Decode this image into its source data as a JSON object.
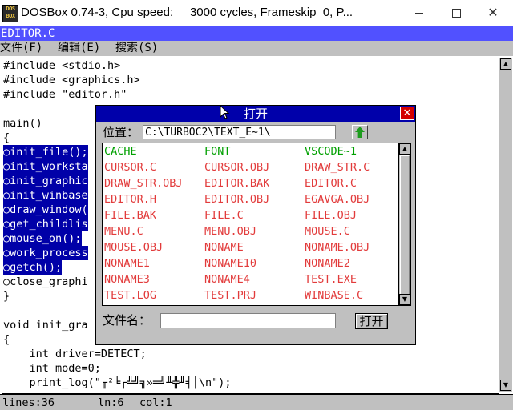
{
  "window": {
    "icon_lines": [
      "DOS",
      "BOX"
    ],
    "title": "DOSBox 0.74-3, Cpu speed:     3000 cycles, Frameskip  0, P...",
    "minimize": "minimize",
    "maximize": "maximize",
    "close": "✕"
  },
  "editor": {
    "caption": "EDITOR.C",
    "menu": [
      "文件(F)",
      "编辑(E)",
      "搜索(S)"
    ],
    "lines": [
      {
        "text": "#include <stdio.h>",
        "selected": false
      },
      {
        "text": "#include <graphics.h>",
        "selected": false
      },
      {
        "text": "#include \"editor.h\"",
        "selected": false
      },
      {
        "text": "",
        "selected": false
      },
      {
        "text": "main()",
        "selected": false
      },
      {
        "text": "{",
        "selected": false
      },
      {
        "text": "\tinit_file();",
        "selected": true
      },
      {
        "text": "\tinit_worksta",
        "selected": true
      },
      {
        "text": "\tinit_graphic",
        "selected": true
      },
      {
        "text": "\tinit_winbase",
        "selected": true
      },
      {
        "text": "\tdraw_window(",
        "selected": true
      },
      {
        "text": "\tget_childlis",
        "selected": true
      },
      {
        "text": "\tmouse_on();",
        "selected": true
      },
      {
        "text": "\twork_process",
        "selected": true
      },
      {
        "text": "\tgetch();",
        "selected": true
      },
      {
        "text": "\tclose_graphi",
        "selected": false
      },
      {
        "text": "}",
        "selected": false
      },
      {
        "text": "",
        "selected": false
      },
      {
        "text": "void init_gra",
        "selected": false
      },
      {
        "text": "{",
        "selected": false
      },
      {
        "text": "    int driver=DETECT;",
        "selected": false
      },
      {
        "text": "    int mode=0;",
        "selected": false
      },
      {
        "text": "    print_log(\"╓²╘┌╩╝╗»═╝╨╬╜╡│\\n\");",
        "selected": false
      }
    ],
    "status": {
      "lines": "lines:36",
      "ln": "ln:6",
      "col": "col:1"
    }
  },
  "dialog": {
    "title": "打开",
    "close": "✕",
    "path_label": "位置：",
    "path_value": "C:\\TURBOC2\\TEXT_E~1\\",
    "name_label": "文件名：",
    "name_value": "",
    "open_button": "打开",
    "files": [
      {
        "name": "CACHE",
        "dir": true
      },
      {
        "name": "FONT",
        "dir": true
      },
      {
        "name": "VSCODE~1",
        "dir": true
      },
      {
        "name": "CURSOR.C",
        "dir": false
      },
      {
        "name": "CURSOR.OBJ",
        "dir": false
      },
      {
        "name": "DRAW_STR.C",
        "dir": false
      },
      {
        "name": "DRAW_STR.OBJ",
        "dir": false
      },
      {
        "name": "EDITOR.BAK",
        "dir": false
      },
      {
        "name": "EDITOR.C",
        "dir": false
      },
      {
        "name": "EDITOR.H",
        "dir": false
      },
      {
        "name": "EDITOR.OBJ",
        "dir": false
      },
      {
        "name": "EGAVGA.OBJ",
        "dir": false
      },
      {
        "name": "FILE.BAK",
        "dir": false
      },
      {
        "name": "FILE.C",
        "dir": false
      },
      {
        "name": "FILE.OBJ",
        "dir": false
      },
      {
        "name": "MENU.C",
        "dir": false
      },
      {
        "name": "MENU.OBJ",
        "dir": false
      },
      {
        "name": "MOUSE.C",
        "dir": false
      },
      {
        "name": "MOUSE.OBJ",
        "dir": false
      },
      {
        "name": "NONAME",
        "dir": false
      },
      {
        "name": "NONAME.OBJ",
        "dir": false
      },
      {
        "name": "NONAME1",
        "dir": false
      },
      {
        "name": "NONAME10",
        "dir": false
      },
      {
        "name": "NONAME2",
        "dir": false
      },
      {
        "name": "NONAME3",
        "dir": false
      },
      {
        "name": "NONAME4",
        "dir": false
      },
      {
        "name": "TEST.EXE",
        "dir": false
      },
      {
        "name": "TEST.LOG",
        "dir": false
      },
      {
        "name": "TEST.PRJ",
        "dir": false
      },
      {
        "name": "WINBASE.C",
        "dir": false
      }
    ]
  },
  "colors": {
    "caption_bg": "#5151ff",
    "selection_bg": "#0000a8",
    "dir_color": "#00a000",
    "file_color": "#e23b3b",
    "dialog_title_bg": "#0000aa"
  }
}
